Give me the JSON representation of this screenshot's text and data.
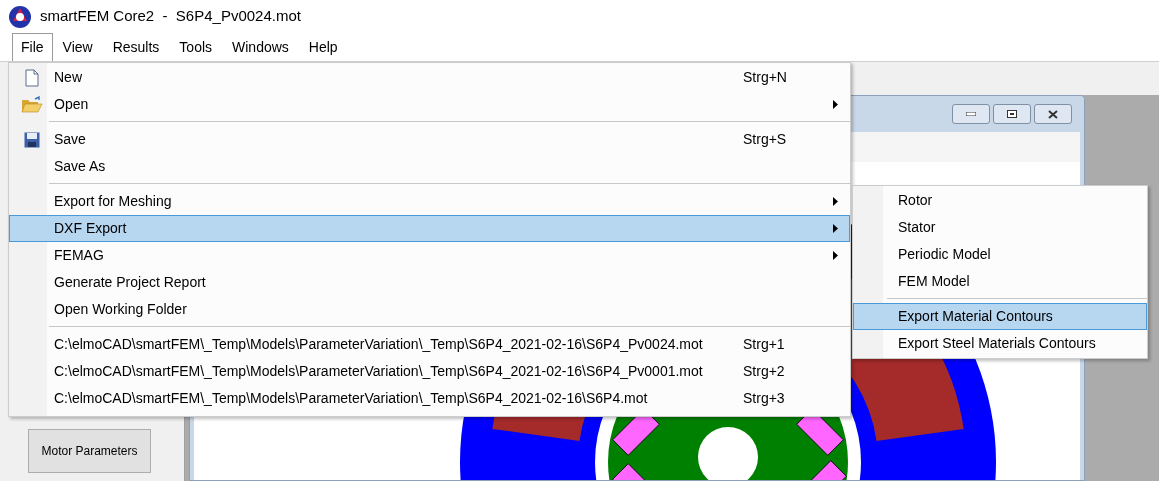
{
  "window": {
    "title": "smartFEM Core2  -  S6P4_Pv0024.mot"
  },
  "menubar": [
    {
      "label": "File",
      "selected": true
    },
    {
      "label": "View",
      "selected": false
    },
    {
      "label": "Results",
      "selected": false
    },
    {
      "label": "Tools",
      "selected": false
    },
    {
      "label": "Windows",
      "selected": false
    },
    {
      "label": "Help",
      "selected": false
    }
  ],
  "file_menu": [
    [
      {
        "kind": "document",
        "label": "New",
        "shortcut": "Strg+N",
        "submenu": false,
        "selected": false
      },
      {
        "kind": "folder",
        "label": "Open",
        "submenu": true,
        "selected": false
      }
    ],
    [
      {
        "kind": "disk",
        "label": "Save",
        "shortcut": "Strg+S",
        "submenu": false,
        "selected": false
      },
      {
        "kind": "plain",
        "label": "Save As",
        "submenu": false,
        "selected": false
      }
    ],
    [
      {
        "kind": "plain",
        "label": "Export for Meshing",
        "submenu": true,
        "selected": false
      },
      {
        "kind": "plain",
        "label": "DXF Export",
        "submenu": true,
        "selected": true
      },
      {
        "kind": "plain",
        "label": "FEMAG",
        "submenu": true,
        "selected": false
      },
      {
        "kind": "plain",
        "label": "Generate  Project Report",
        "submenu": false,
        "selected": false
      },
      {
        "kind": "plain",
        "label": "Open Working Folder",
        "submenu": false,
        "selected": false
      }
    ],
    [
      {
        "kind": "plain",
        "label": "C:\\elmoCAD\\smartFEM\\_Temp\\Models\\ParameterVariation\\_Temp\\S6P4_2021-02-16\\S6P4_Pv0024.mot",
        "shortcut": "Strg+1",
        "submenu": false,
        "selected": false
      },
      {
        "kind": "plain",
        "label": "C:\\elmoCAD\\smartFEM\\_Temp\\Models\\ParameterVariation\\_Temp\\S6P4_2021-02-16\\S6P4_Pv0001.mot",
        "shortcut": "Strg+2",
        "submenu": false,
        "selected": false
      },
      {
        "kind": "plain",
        "label": "C:\\elmoCAD\\smartFEM\\_Temp\\Models\\ParameterVariation\\_Temp\\S6P4_2021-02-16\\S6P4.mot",
        "shortcut": "Strg+3",
        "submenu": false,
        "selected": false
      }
    ]
  ],
  "dxf_submenu": [
    [
      {
        "label": "Rotor",
        "selected": false
      },
      {
        "label": "Stator",
        "selected": false
      },
      {
        "label": "Periodic Model",
        "selected": false
      },
      {
        "label": "FEM Model",
        "selected": false
      }
    ],
    [
      {
        "label": "Export Material Contours",
        "selected": true
      },
      {
        "label": "Export Steel Materials Contours",
        "selected": false
      }
    ]
  ],
  "side_panel": {
    "button": "Motor Parameters"
  }
}
